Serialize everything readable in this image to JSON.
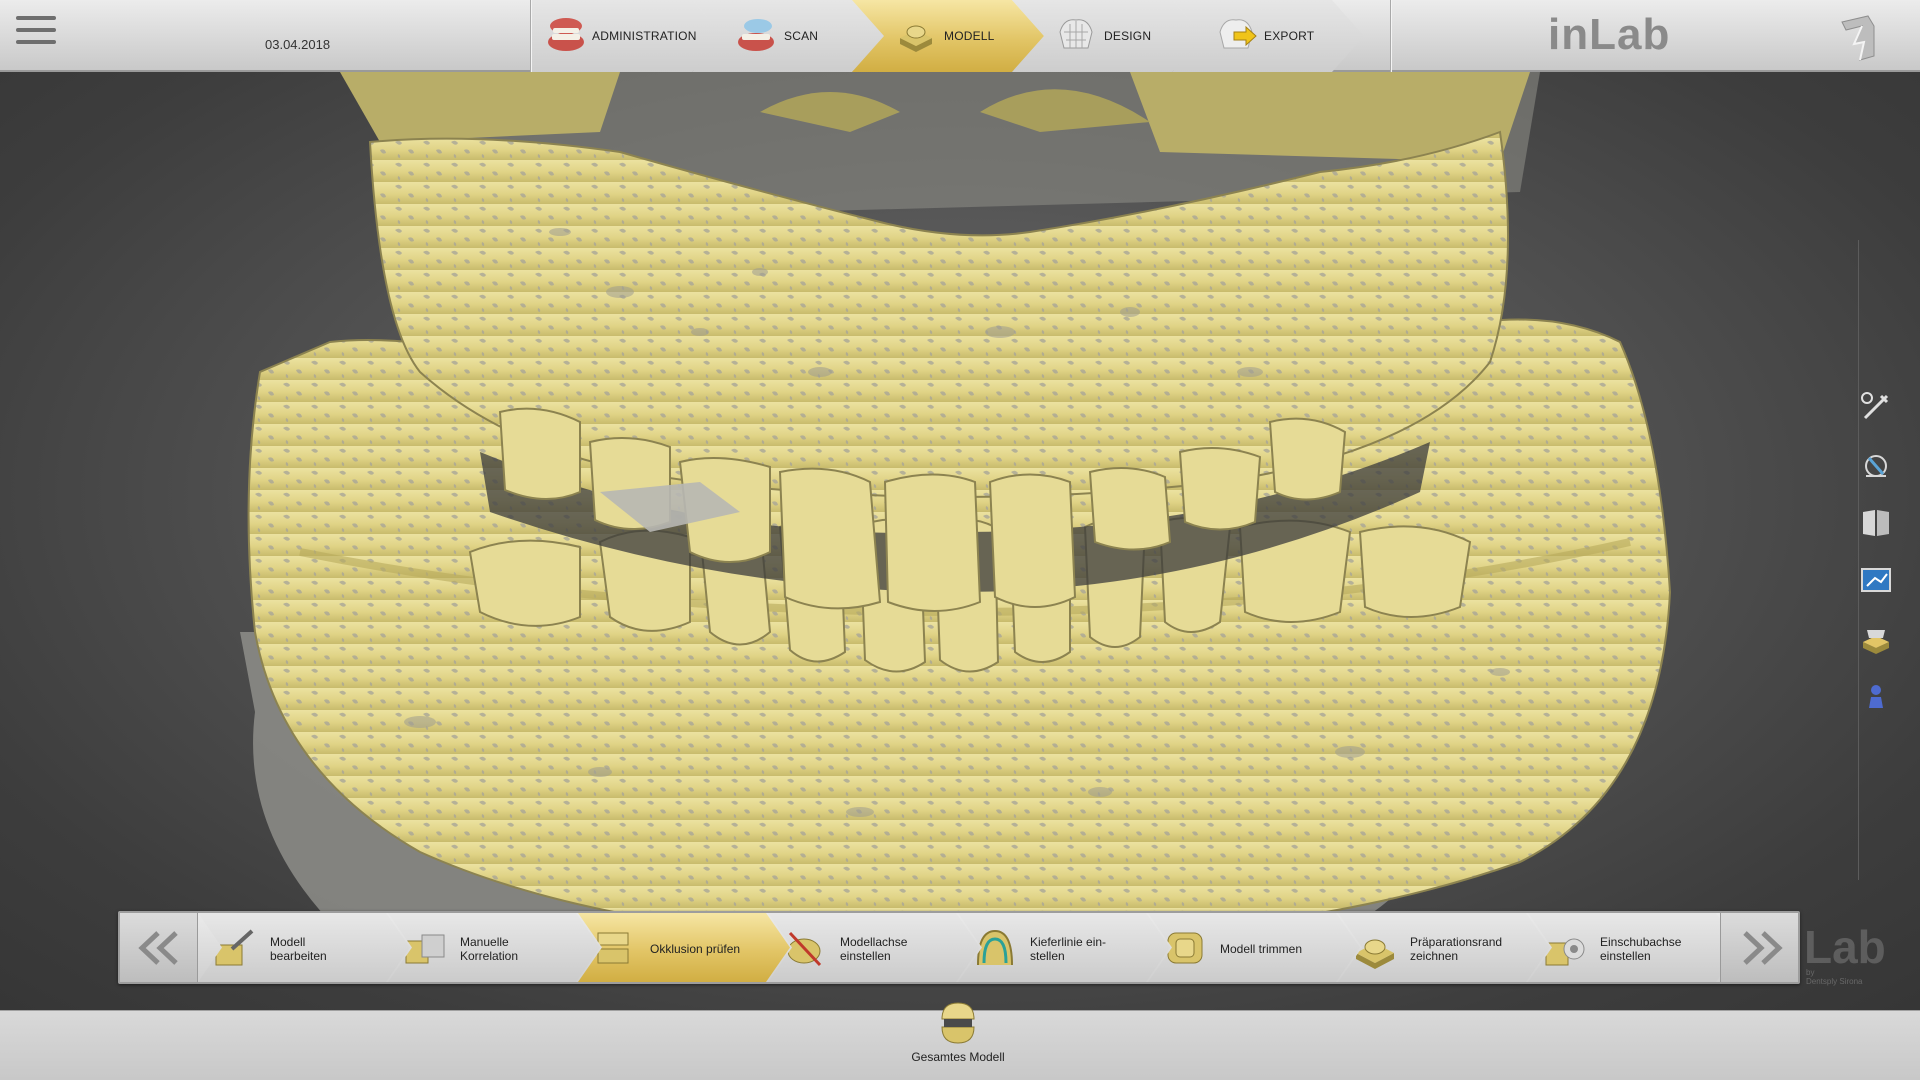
{
  "header": {
    "date": "03.04.2018",
    "brand": "inLab",
    "steps": [
      {
        "label": "ADMINISTRATION",
        "icon": "jaw-icon",
        "active": false
      },
      {
        "label": "SCAN",
        "icon": "jaw-icon",
        "active": false
      },
      {
        "label": "MODELL",
        "icon": "model-icon",
        "active": true
      },
      {
        "label": "DESIGN",
        "icon": "crown-icon",
        "active": false
      },
      {
        "label": "EXPORT",
        "icon": "export-icon",
        "active": false
      }
    ]
  },
  "right_tools": [
    {
      "icon": "tools-icon"
    },
    {
      "icon": "view-icon"
    },
    {
      "icon": "catalog-icon"
    },
    {
      "icon": "screenshot-icon"
    },
    {
      "icon": "library-icon"
    },
    {
      "icon": "figure-icon"
    }
  ],
  "workflow": {
    "steps": [
      {
        "label_line1": "Modell",
        "label_line2": "bearbeiten",
        "icon": "model-edit-icon",
        "active": false
      },
      {
        "label_line1": "Manuelle",
        "label_line2": "Korrelation",
        "icon": "correlation-icon",
        "active": false
      },
      {
        "label_line1": "Okklusion prüfen",
        "label_line2": "",
        "icon": "occlusion-icon",
        "active": true
      },
      {
        "label_line1": "Modellachse",
        "label_line2": "einstellen",
        "icon": "model-axis-icon",
        "active": false
      },
      {
        "label_line1": "Kieferlinie ein-",
        "label_line2": "stellen",
        "icon": "jaw-line-icon",
        "active": false
      },
      {
        "label_line1": "Modell trimmen",
        "label_line2": "",
        "icon": "trim-icon",
        "active": false
      },
      {
        "label_line1": "Präparationsrand",
        "label_line2": "zeichnen",
        "icon": "margin-icon",
        "active": false
      },
      {
        "label_line1": "Einschubachse",
        "label_line2": "einstellen",
        "icon": "insertion-axis-icon",
        "active": false
      }
    ]
  },
  "watermark": {
    "text": "Lab",
    "sub1": "by",
    "sub2": "Dentsply Sirona"
  },
  "bottom": {
    "full_model_label": "Gesamtes Modell"
  },
  "colors": {
    "accent": "#e2c566",
    "model_yellow": "#e2d68a",
    "model_gray": "#9a9a92"
  }
}
